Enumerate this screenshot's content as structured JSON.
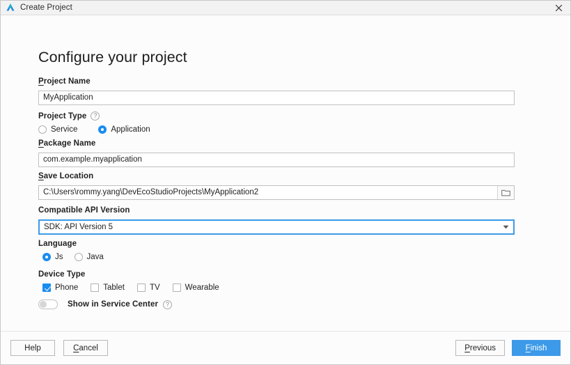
{
  "window": {
    "title": "Create Project",
    "logo_icon": "deveco-studio-logo-icon",
    "close_icon": "close-icon"
  },
  "page": {
    "heading": "Configure your project"
  },
  "colors": {
    "accent": "#1a8cf0",
    "focus_border": "#3c9ae8",
    "primary_button": "#3c9ae8",
    "background": "#fcfcfc",
    "titlebar": "#f2f2f2"
  },
  "fields": {
    "project_name": {
      "label_mnemonic": "P",
      "label_rest": "roject Name",
      "value": "MyApplication"
    },
    "project_type": {
      "label": "Project Type",
      "help_icon": "help-icon",
      "help_glyph": "?",
      "options": [
        {
          "label": "Service",
          "selected": false
        },
        {
          "label": "Application",
          "selected": true
        }
      ]
    },
    "package_name": {
      "label_mnemonic": "P",
      "label_rest": "ackage Name",
      "value": "com.example.myapplication"
    },
    "save_location": {
      "label_mnemonic": "S",
      "label_rest": "ave Location",
      "value": "C:\\Users\\rommy.yang\\DevEcoStudioProjects\\MyApplication2",
      "browse_icon": "folder-icon"
    },
    "api_version": {
      "label": "Compatible API Version",
      "value": "SDK: API Version 5",
      "arrow_icon": "chevron-down-icon"
    },
    "language": {
      "label": "Language",
      "options": [
        {
          "label": "Js",
          "selected": true
        },
        {
          "label": "Java",
          "selected": false
        }
      ]
    },
    "device_type": {
      "label": "Device Type",
      "options": [
        {
          "label": "Phone",
          "checked": true
        },
        {
          "label": "Tablet",
          "checked": false
        },
        {
          "label": "TV",
          "checked": false
        },
        {
          "label": "Wearable",
          "checked": false
        }
      ]
    },
    "service_center": {
      "label": "Show in Service Center",
      "enabled": false,
      "help_icon": "help-icon",
      "help_glyph": "?"
    }
  },
  "footer": {
    "help_label": "Help",
    "cancel_mnemonic": "C",
    "cancel_rest": "ancel",
    "previous_mnemonic": "P",
    "previous_rest": "revious",
    "finish_mnemonic": "F",
    "finish_rest": "inish"
  }
}
